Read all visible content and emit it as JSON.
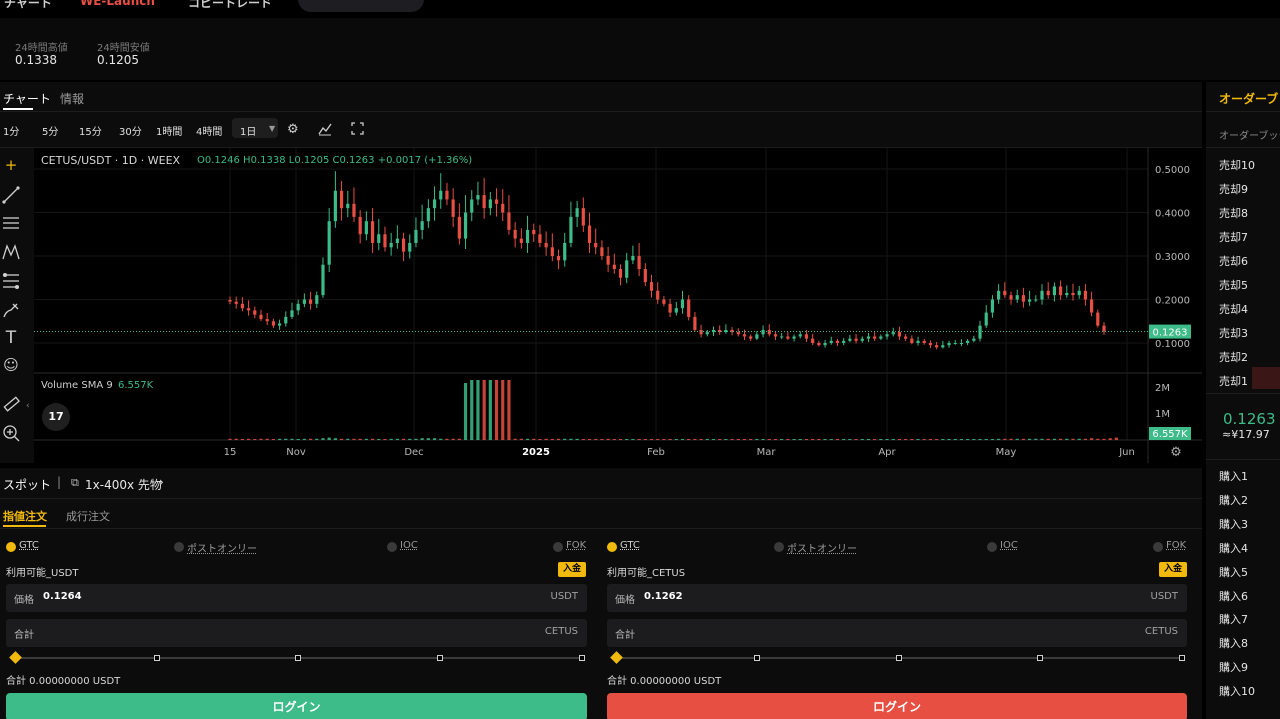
{
  "topbar": {
    "left_text": "チャート",
    "launch": "WE-Launch",
    "middle": "コピートレード"
  },
  "stats": [
    {
      "label": "24時間高値",
      "value": "0.1338"
    },
    {
      "label": "24時間安値",
      "value": "0.1205"
    }
  ],
  "chart_tabs": [
    "チャート",
    "情報"
  ],
  "timeframes": [
    "1分",
    "5分",
    "15分",
    "30分",
    "1時間",
    "4時間",
    "1日"
  ],
  "chart_data": {
    "type": "candlestick",
    "symbol_line": "CETUS/USDT · 1D · WEEX",
    "ohlc": {
      "o": "0.1246",
      "h": "0.1338",
      "l": "0.1205",
      "c": "0.1263",
      "chg": "+0.0017 (+1.36%)"
    },
    "y_ticks": [
      "0.5000",
      "0.4000",
      "0.3000",
      "0.2000",
      "0.1000"
    ],
    "y_tick_values": [
      0.5,
      0.4,
      0.3,
      0.2,
      0.1
    ],
    "x_ticks": [
      "15",
      "Nov",
      "Dec",
      "2025",
      "Feb",
      "Mar",
      "Apr",
      "May",
      "Jun"
    ],
    "last_price": "0.1263",
    "last_value": 0.1263,
    "volume_label": "Volume SMA 9",
    "volume_value": "6.557K",
    "volume_ticks": [
      "2M",
      "1M"
    ],
    "close_series": [
      0.195,
      0.19,
      0.18,
      0.175,
      0.165,
      0.155,
      0.15,
      0.14,
      0.145,
      0.16,
      0.175,
      0.19,
      0.2,
      0.19,
      0.21,
      0.28,
      0.38,
      0.45,
      0.41,
      0.42,
      0.39,
      0.35,
      0.38,
      0.33,
      0.35,
      0.32,
      0.33,
      0.34,
      0.31,
      0.33,
      0.36,
      0.38,
      0.41,
      0.43,
      0.45,
      0.43,
      0.39,
      0.34,
      0.4,
      0.43,
      0.44,
      0.41,
      0.43,
      0.42,
      0.4,
      0.36,
      0.34,
      0.33,
      0.36,
      0.35,
      0.33,
      0.32,
      0.3,
      0.29,
      0.33,
      0.39,
      0.41,
      0.37,
      0.33,
      0.32,
      0.3,
      0.28,
      0.27,
      0.25,
      0.29,
      0.3,
      0.27,
      0.24,
      0.22,
      0.2,
      0.19,
      0.17,
      0.18,
      0.2,
      0.16,
      0.13,
      0.12,
      0.125,
      0.13,
      0.125,
      0.13,
      0.125,
      0.12,
      0.115,
      0.11,
      0.12,
      0.13,
      0.12,
      0.115,
      0.115,
      0.11,
      0.115,
      0.12,
      0.11,
      0.1,
      0.095,
      0.1,
      0.105,
      0.1,
      0.105,
      0.11,
      0.105,
      0.11,
      0.115,
      0.11,
      0.115,
      0.12,
      0.125,
      0.115,
      0.11,
      0.1,
      0.105,
      0.1,
      0.095,
      0.09,
      0.095,
      0.1,
      0.1,
      0.1,
      0.105,
      0.11,
      0.14,
      0.17,
      0.2,
      0.22,
      0.21,
      0.2,
      0.21,
      0.195,
      0.2,
      0.2,
      0.22,
      0.21,
      0.23,
      0.21,
      0.215,
      0.21,
      0.22,
      0.2,
      0.17,
      0.14,
      0.1263
    ],
    "volume_series": [
      0.02,
      0.02,
      0.01,
      0.02,
      0.01,
      0.02,
      0.02,
      0.01,
      0.02,
      0.02,
      0.02,
      0.01,
      0.02,
      0.02,
      0.02,
      0.03,
      0.04,
      0.03,
      0.02,
      0.02,
      0.02,
      0.02,
      0.02,
      0.02,
      0.01,
      0.01,
      0.02,
      0.02,
      0.02,
      0.02,
      0.02,
      0.03,
      0.03,
      0.03,
      0.02,
      0.02,
      0.02,
      0.02,
      0.95,
      1.0,
      1.0,
      1.0,
      1.0,
      1.0,
      1.0,
      1.0,
      0.02,
      0.02,
      0.02,
      0.02,
      0.01,
      0.02,
      0.01,
      0.02,
      0.02,
      0.02,
      0.02,
      0.01,
      0.01,
      0.01,
      0.01,
      0.02,
      0.01,
      0.01,
      0.01,
      0.01,
      0.01,
      0.01,
      0.01,
      0.01,
      0.01,
      0.01,
      0.01,
      0.01,
      0.01,
      0.01,
      0.01,
      0.01,
      0.01,
      0.01,
      0.01,
      0.01,
      0.01,
      0.01,
      0.01,
      0.01,
      0.01,
      0.01,
      0.01,
      0.01,
      0.01,
      0.01,
      0.01,
      0.01,
      0.01,
      0.01,
      0.01,
      0.01,
      0.01,
      0.01,
      0.01,
      0.01,
      0.01,
      0.01,
      0.01,
      0.01,
      0.01,
      0.01,
      0.01,
      0.01,
      0.01,
      0.01,
      0.01,
      0.01,
      0.01,
      0.01,
      0.01,
      0.01,
      0.01,
      0.01,
      0.01,
      0.01,
      0.01,
      0.01,
      0.02,
      0.02,
      0.02,
      0.02,
      0.02,
      0.02,
      0.02,
      0.02,
      0.02,
      0.02,
      0.02,
      0.02,
      0.02,
      0.02,
      0.02,
      0.03,
      0.02,
      0.02,
      0.03,
      0.04
    ]
  },
  "order": {
    "spot_label": "スポット",
    "futures_label": "1x-400x 先物",
    "tab_limit": "指値注文",
    "tab_market": "成行注文",
    "opts": [
      "GTC",
      "ポストオンリー",
      "IOC",
      "FOK"
    ],
    "buy": {
      "available": "利用可能_USDT",
      "deposit": "入金",
      "price_label": "価格",
      "price": "0.1264",
      "price_unit": "USDT",
      "total_label": "合計",
      "total_unit": "CETUS",
      "sum": "合計 0.00000000 USDT",
      "button": "ログイン"
    },
    "sell": {
      "available": "利用可能_CETUS",
      "deposit": "入金",
      "price_label": "価格",
      "price": "0.1262",
      "price_unit": "USDT",
      "total_label": "合計",
      "total_unit": "CETUS",
      "sum": "合計 0.00000000 USDT",
      "button": "ログイン"
    },
    "buy_color": "#3dbb89",
    "sell_color": "#e84f43"
  },
  "book": {
    "title": "オーダーブッ",
    "subtitle": "オーダーブック",
    "asks": [
      "売却10",
      "売却9",
      "売却8",
      "売却7",
      "売却6",
      "売却5",
      "売却4",
      "売却3",
      "売却2",
      "売却1"
    ],
    "mid_price": "0.1263",
    "mid_fiat": "≈¥17.97",
    "bids": [
      "購入1",
      "購入2",
      "購入3",
      "購入4",
      "購入5",
      "購入6",
      "購入7",
      "購入8",
      "購入9",
      "購入10"
    ]
  }
}
